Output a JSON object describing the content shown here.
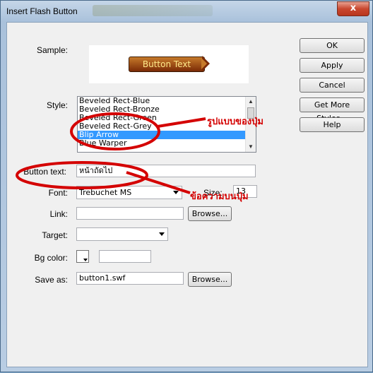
{
  "window": {
    "title": "Insert Flash Button",
    "close_label": "x"
  },
  "labels": {
    "sample": "Sample:",
    "style": "Style:",
    "button_text": "Button text:",
    "font": "Font:",
    "size": "Size:",
    "link": "Link:",
    "target": "Target:",
    "bg_color": "Bg color:",
    "save_as": "Save as:"
  },
  "sample": {
    "button_label": "Button Text"
  },
  "style_list": {
    "items": [
      "Beveled Rect-Blue",
      "Beveled Rect-Bronze",
      "Beveled Rect-Green",
      "Beveled Rect-Grey",
      "Blip Arrow",
      "Blue Warper"
    ],
    "selected_index": 4
  },
  "fields": {
    "button_text": "หน้าถัดไป",
    "font": "Trebuchet MS",
    "size": "13",
    "link": "",
    "target": "",
    "bg_color": "",
    "save_as": "button1.swf"
  },
  "buttons": {
    "ok": "OK",
    "apply": "Apply",
    "cancel": "Cancel",
    "get_more_styles": "Get More Styles...",
    "help": "Help",
    "browse_link": "Browse...",
    "browse_save": "Browse..."
  },
  "annotations": {
    "style_note": "รูปแบบของปุ่ม",
    "text_note": "ข้อความบนปุ่ม",
    "color": "#d40000"
  }
}
